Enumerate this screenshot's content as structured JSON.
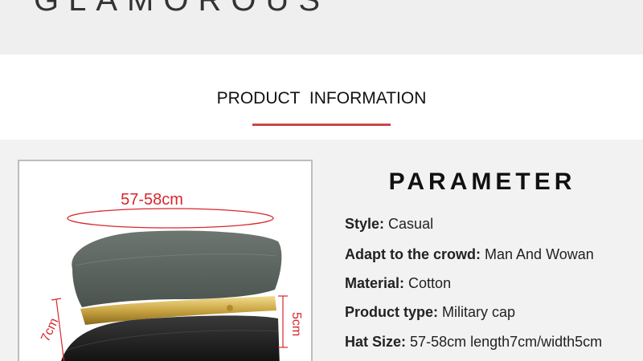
{
  "brand": {
    "name": "GLAMOROUS"
  },
  "section": {
    "title": "PRODUCT  INFORMATION"
  },
  "image": {
    "circumference": "57-58cm",
    "length": "7cm",
    "width": "5cm"
  },
  "parameter": {
    "title": "PARAMETER",
    "specs": [
      {
        "key": "Style:",
        "value": "Casual"
      },
      {
        "key": "Adapt to the crowd:",
        "value": "Man And Wowan"
      },
      {
        "key": "Material:",
        "value": "Cotton"
      },
      {
        "key": "Product type:",
        "value": "Military cap"
      },
      {
        "key": "Hat Size:",
        "value": "57-58cm length7cm/width5cm"
      }
    ]
  },
  "colors": {
    "accent": "#c8474a",
    "dim_red": "#d9262c",
    "gold": "#c9a443",
    "hat_gray": "#5c6560"
  }
}
